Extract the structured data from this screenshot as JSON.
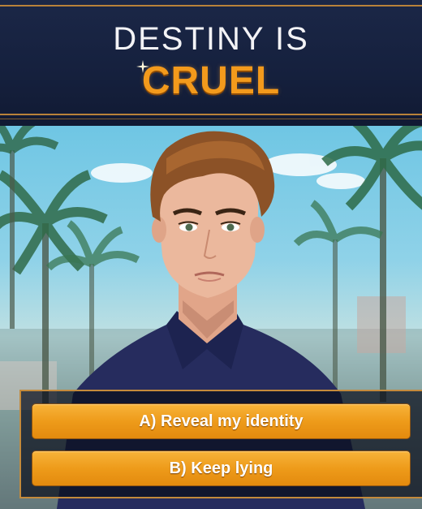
{
  "banner": {
    "line1": "DESTINY IS",
    "line2": "CRUEL"
  },
  "colors": {
    "banner_bg": "#15203d",
    "accent_gold": "#b8823a",
    "title_orange": "#f39a1c",
    "button_orange": "#ee9b1a",
    "button_text": "#ffffff"
  },
  "choices": [
    {
      "label": "A) Reveal my identity"
    },
    {
      "label": "B) Keep lying"
    }
  ],
  "scene": {
    "character": "man-brown-hair-navy-shirt",
    "background": "palm-trees-sky"
  }
}
